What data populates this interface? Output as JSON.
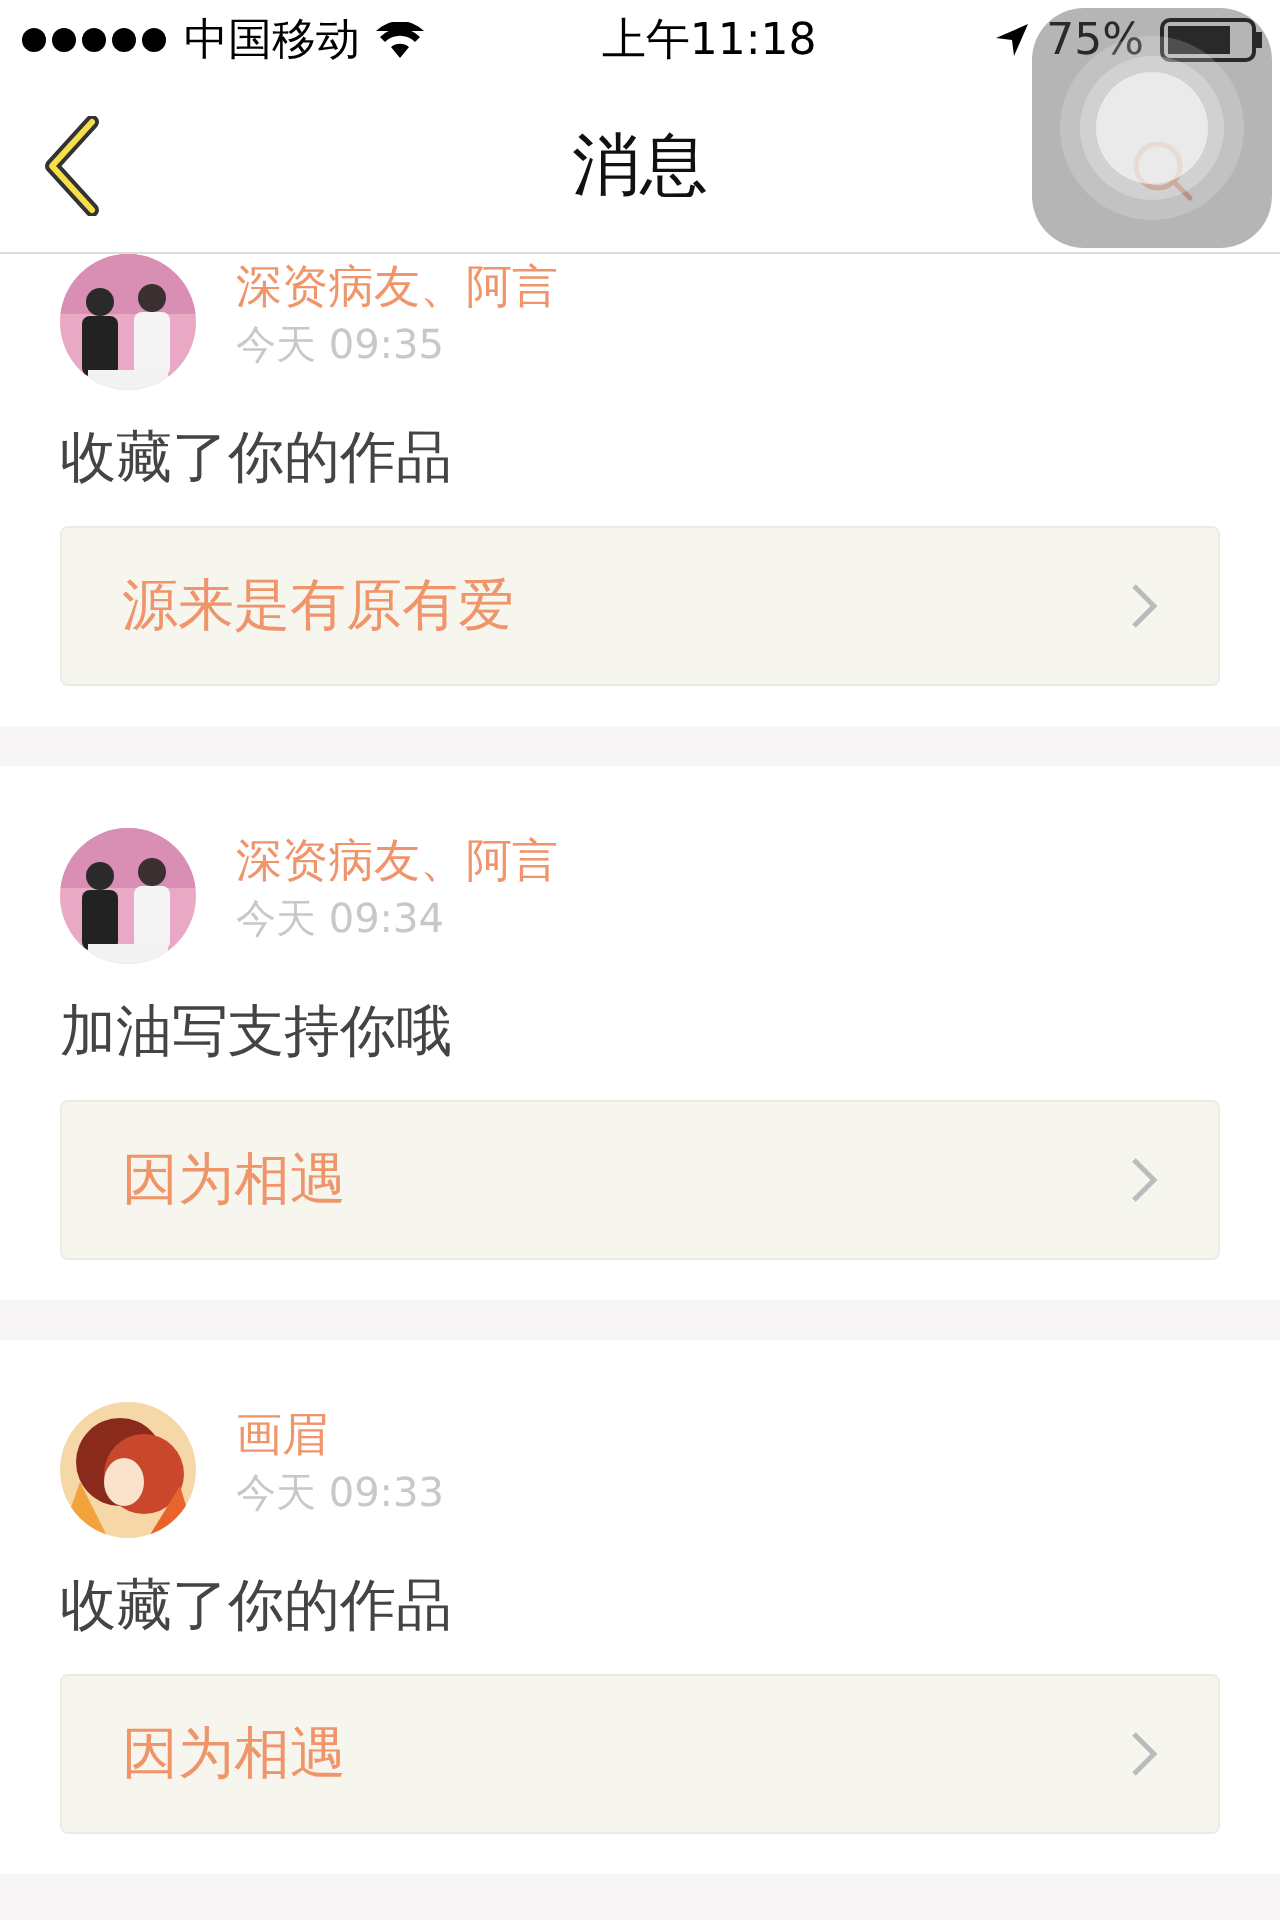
{
  "status_bar": {
    "carrier": "中国移动",
    "time": "上午11:18",
    "battery": "75%"
  },
  "nav": {
    "title": "消息"
  },
  "messages": [
    {
      "users": "深资病友、阿言",
      "time": "今天 09:35",
      "action": "收藏了你的作品",
      "work": "源来是有原有爱"
    },
    {
      "users": "深资病友、阿言",
      "time": "今天 09:34",
      "action": "加油写支持你哦",
      "work": "因为相遇"
    },
    {
      "users": "画眉",
      "time": "今天 09:33",
      "action": "收藏了你的作品",
      "work": "因为相遇"
    }
  ]
}
